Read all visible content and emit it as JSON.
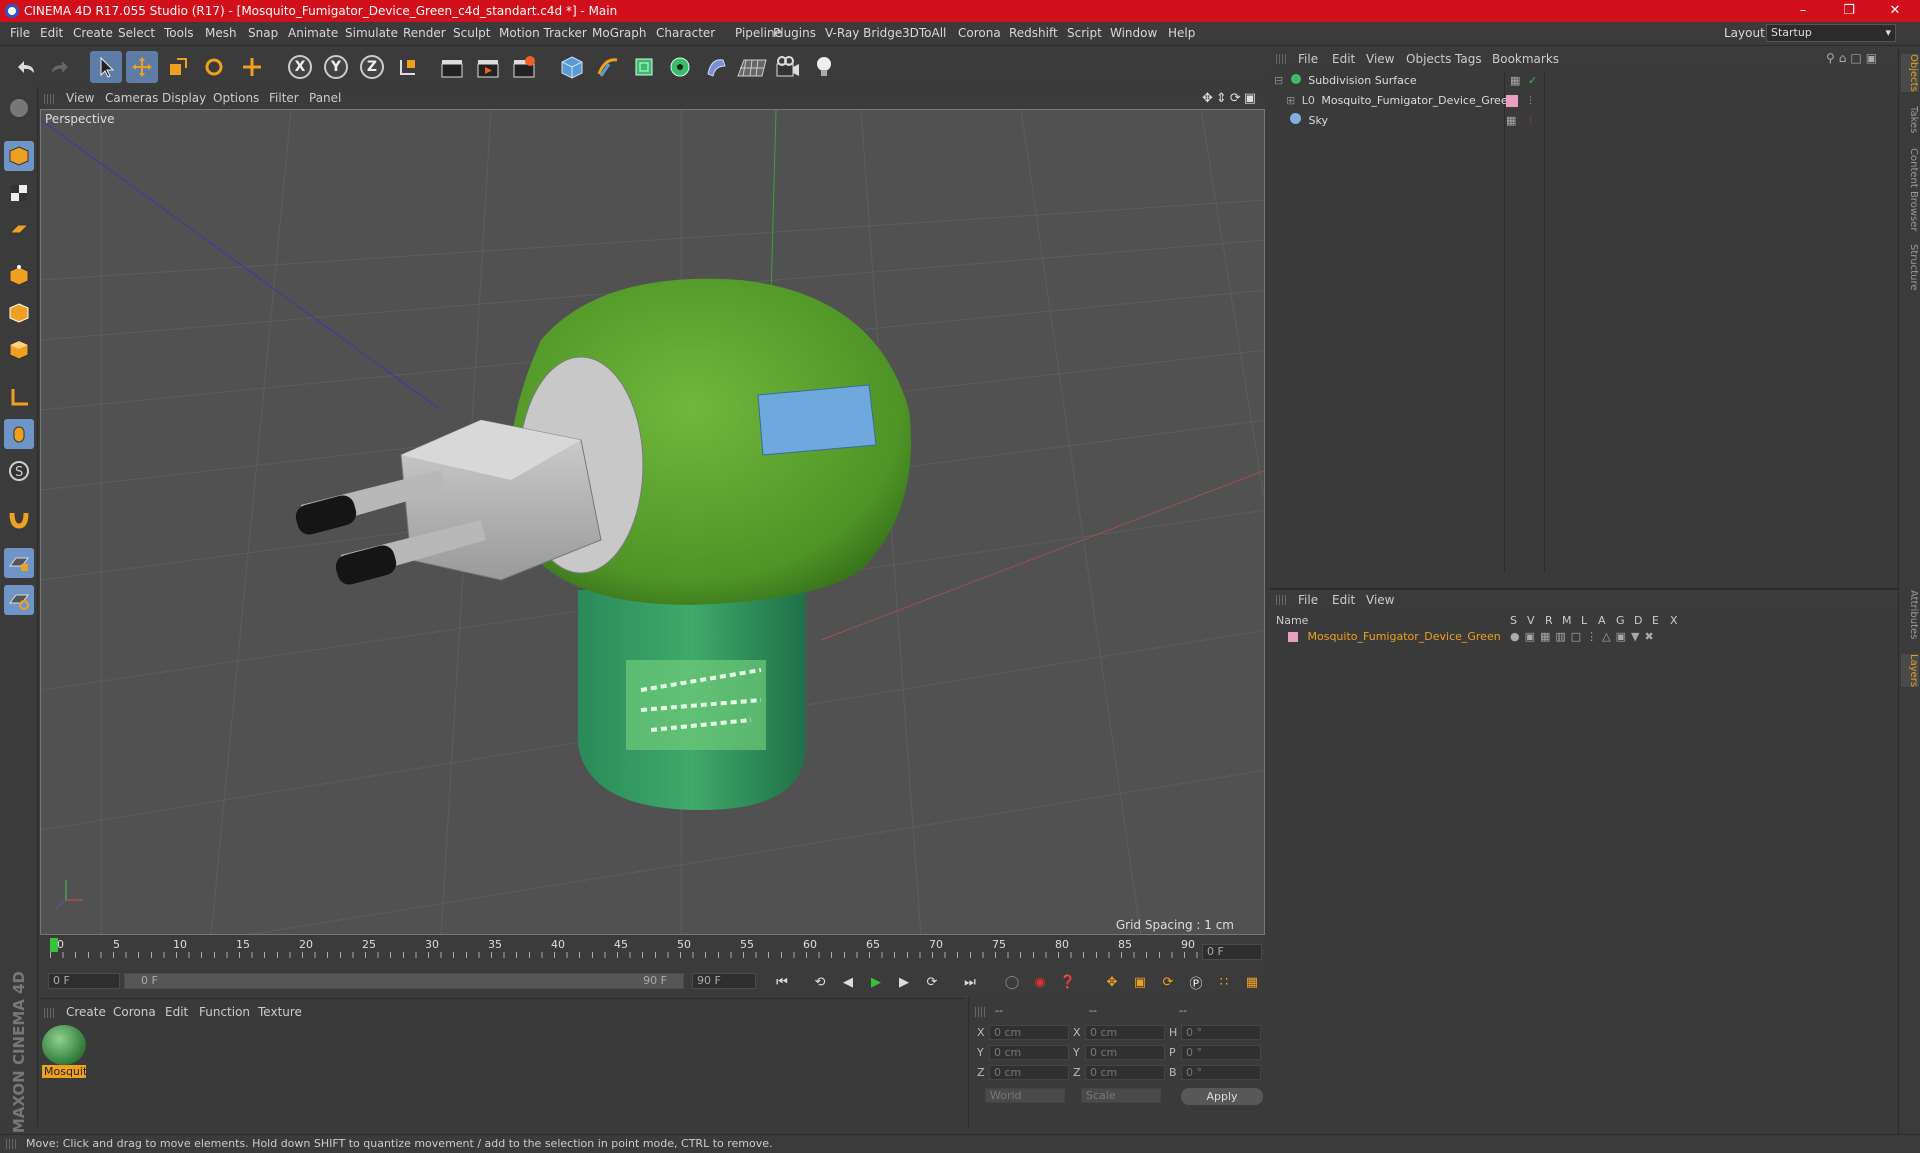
{
  "window": {
    "title": "CINEMA 4D R17.055 Studio (R17) - [Mosquito_Fumigator_Device_Green_c4d_standart.c4d *] - Main",
    "controls": [
      "–",
      "❐",
      "✕"
    ]
  },
  "menubar": {
    "items": [
      "File",
      "Edit",
      "Create",
      "Select",
      "Tools",
      "Mesh",
      "Snap",
      "Animate",
      "Simulate",
      "Render",
      "Sculpt",
      "Motion Tracker",
      "MoGraph",
      "Character",
      "Pipeline",
      "Plugins",
      "V-Ray Bridge",
      "3DToAll",
      "Corona",
      "Redshift",
      "Script",
      "Window",
      "Help"
    ],
    "layout_label": "Layout:",
    "layout_value": "Startup"
  },
  "toolbar": {
    "axis_x": "X",
    "axis_y": "Y",
    "axis_z": "Z"
  },
  "viewport": {
    "menu": [
      "View",
      "Cameras",
      "Display",
      "Options",
      "Filter",
      "Panel"
    ],
    "camera_label": "Perspective",
    "grid_spacing": "Grid Spacing : 1 cm",
    "colors": {
      "bg": "#515151",
      "grid": "#5c5c5c",
      "body": "#5fa536",
      "base": "#3a9a5a",
      "plug": "#bdbdbd",
      "window": "#6fa8dc"
    }
  },
  "timeline": {
    "ticks": [
      "0",
      "5",
      "10",
      "15",
      "20",
      "25",
      "30",
      "35",
      "40",
      "45",
      "50",
      "55",
      "60",
      "65",
      "70",
      "75",
      "80",
      "85",
      "90"
    ],
    "current_frame": "0 F"
  },
  "playbar": {
    "start": "0 F",
    "range_start": "0 F",
    "range_end": "90 F",
    "end": "90 F"
  },
  "materials": {
    "menu": [
      "Create",
      "Corona",
      "Edit",
      "Function",
      "Texture"
    ],
    "item_label": "Mosquit"
  },
  "coordinates": {
    "header": [
      "--",
      "--",
      "--"
    ],
    "rows": [
      {
        "l1": "X",
        "v1": "0 cm",
        "l2": "X",
        "v2": "0 cm",
        "l3": "H",
        "v3": "0 °"
      },
      {
        "l1": "Y",
        "v1": "0 cm",
        "l2": "Y",
        "v2": "0 cm",
        "l3": "P",
        "v3": "0 °"
      },
      {
        "l1": "Z",
        "v1": "0 cm",
        "l2": "Z",
        "v2": "0 cm",
        "l3": "B",
        "v3": "0 °"
      }
    ],
    "world": "World",
    "scale": "Scale",
    "apply": "Apply"
  },
  "objects": {
    "menu": [
      "File",
      "Edit",
      "View",
      "Objects",
      "Tags",
      "Bookmarks"
    ],
    "items": [
      "Subdivision Surface",
      "Mosquito_Fumigator_Device_Green",
      "Sky"
    ]
  },
  "layers": {
    "menu": [
      "File",
      "Edit",
      "View"
    ],
    "columns": [
      "Name",
      "S",
      "V",
      "R",
      "M",
      "L",
      "A",
      "G",
      "D",
      "E",
      "X"
    ],
    "item": "Mosquito_Fumigator_Device_Green"
  },
  "right_tabs": [
    "Objects",
    "Takes",
    "Content Browser",
    "Structure",
    "Attributes",
    "Layers"
  ],
  "maxon_logo": "MAXON CINEMA 4D",
  "status": "Move: Click and drag to move elements. Hold down SHIFT to quantize movement / add to the selection in point mode, CTRL to remove."
}
